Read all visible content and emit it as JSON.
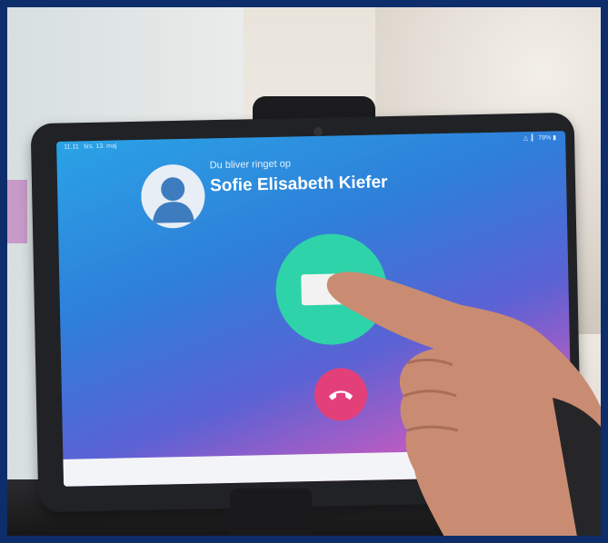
{
  "status_bar": {
    "time": "11.11",
    "date": "tirs. 13. maj",
    "icons": "△ .▎ 78% ▮"
  },
  "call": {
    "caption": "Du bliver ringet op",
    "caller_name": "Sofie Elisabeth Kiefer"
  },
  "icons": {
    "avatar": "person-silhouette",
    "accept": "video-camera",
    "decline": "phone-hangup"
  },
  "colors": {
    "accept": "#2fd3a9",
    "decline": "#e3407a",
    "screen_top": "#2aa3e6",
    "screen_bottom": "#e0508f",
    "border": "#0d2d6b"
  }
}
